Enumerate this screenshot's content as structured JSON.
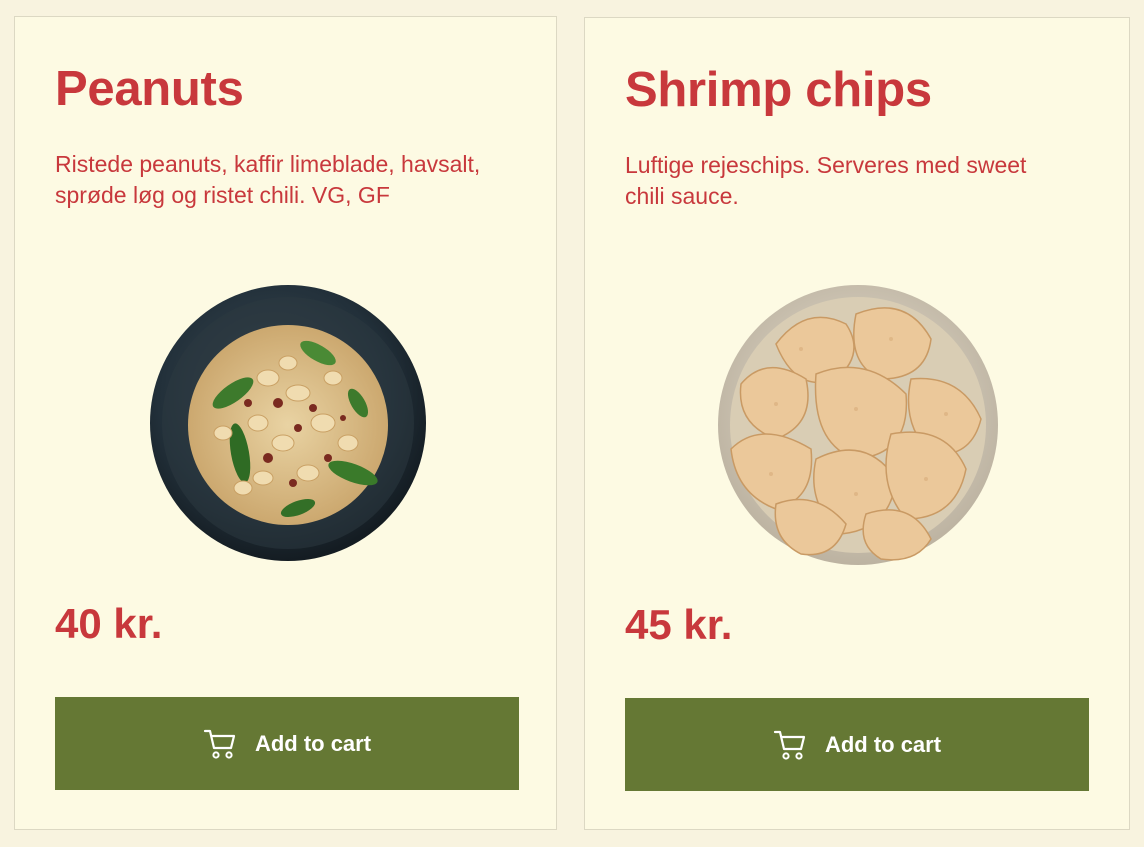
{
  "colors": {
    "page_background": "#f8f3df",
    "card_background": "#fdfae3",
    "accent_red": "#c8383c",
    "button_green": "#657834"
  },
  "products": [
    {
      "title": "Peanuts",
      "description": "Ristede peanuts, kaffir limeblade, havsalt, sprøde løg og ristet chili. VG, GF",
      "price": "40 kr.",
      "button_label": "Add to cart",
      "button_icon": "cart-icon",
      "image_alt": "Bowl of roasted peanuts with kaffir lime leaves and chili"
    },
    {
      "title": "Shrimp chips",
      "description": "Luftige rejeschips. Serveres med sweet chili sauce.",
      "price": "45 kr.",
      "button_label": "Add to cart",
      "button_icon": "cart-icon",
      "image_alt": "Bowl of shrimp chips"
    }
  ]
}
